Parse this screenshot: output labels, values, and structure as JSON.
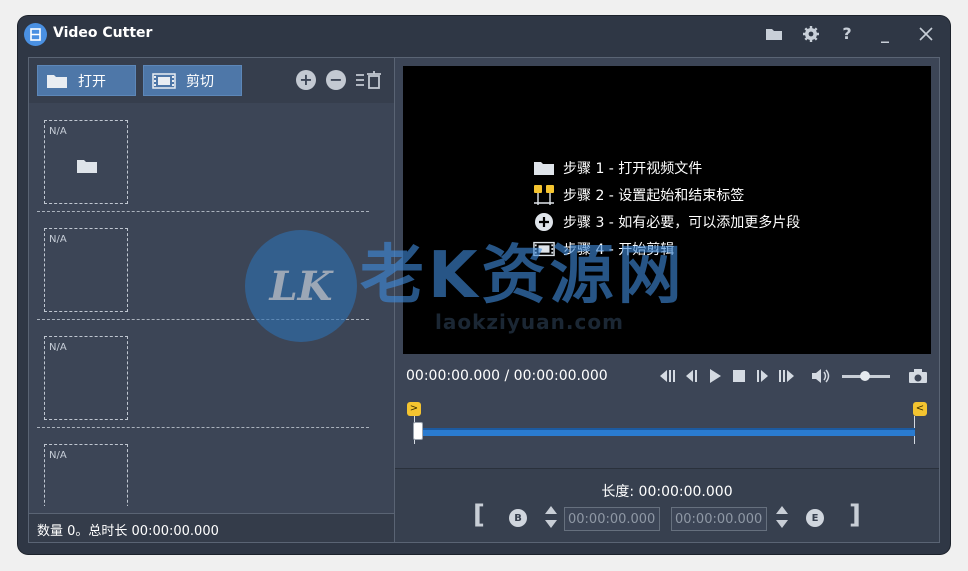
{
  "app": {
    "title": "Video Cutter"
  },
  "toolbar": {
    "open_label": "打开",
    "cut_label": "剪切"
  },
  "clips": [
    {
      "label": "N/A"
    },
    {
      "label": "N/A"
    },
    {
      "label": "N/A"
    },
    {
      "label": "N/A"
    }
  ],
  "status": {
    "text": "数量 0。总时长 00:00:00.000"
  },
  "steps": [
    {
      "text": "步骤 1 - 打开视频文件",
      "icon": "folder-icon"
    },
    {
      "text": "步骤 2 - 设置起始和结束标签",
      "icon": "markers-icon"
    },
    {
      "text": "步骤 3 - 如有必要，可以添加更多片段",
      "icon": "add-circle-icon"
    },
    {
      "text": "步骤 4 - 开始剪辑",
      "icon": "film-icon"
    }
  ],
  "player": {
    "time_readout": "00:00:00.000 / 00:00:00.000",
    "start_marker": ">",
    "end_marker": "<"
  },
  "trim": {
    "length_label": "长度: 00:00:00.000",
    "start_value": "00:00:00.000",
    "end_value": "00:00:00.000",
    "begin_badge": "B",
    "end_badge": "E",
    "left_bracket": "[",
    "right_bracket": "]"
  },
  "watermark": {
    "logo": "LK",
    "text": "老K资源网",
    "sub": "laokziyuan.com"
  },
  "colors": {
    "accent_button": "#4e77a8",
    "timeline": "#2a7bd0",
    "marker": "#f4c430",
    "window_bg": "#2f3745"
  }
}
